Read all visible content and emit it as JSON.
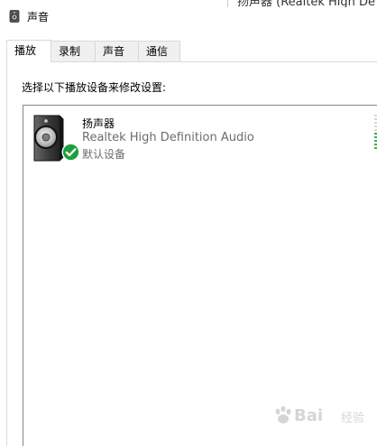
{
  "background_window": {
    "text": "扬声器 (Realtek High De"
  },
  "window": {
    "title": "声音",
    "title_icon": "speaker-icon"
  },
  "tabs": [
    {
      "label": "播放",
      "active": true
    },
    {
      "label": "录制",
      "active": false
    },
    {
      "label": "声音",
      "active": false
    },
    {
      "label": "通信",
      "active": false
    }
  ],
  "playback": {
    "instruction": "选择以下播放设备来修改设置:",
    "devices": [
      {
        "name": "扬声器",
        "description": "Realtek High Definition Audio",
        "status": "默认设备",
        "icon": "speaker-icon",
        "badge_icon": "check-icon",
        "badge_color": "#1e9e3e",
        "level_color": "#3fae53",
        "level_active_fraction": 0.45
      }
    ]
  },
  "watermark": {
    "brand": "Bai",
    "brand_suffix": "经验"
  }
}
